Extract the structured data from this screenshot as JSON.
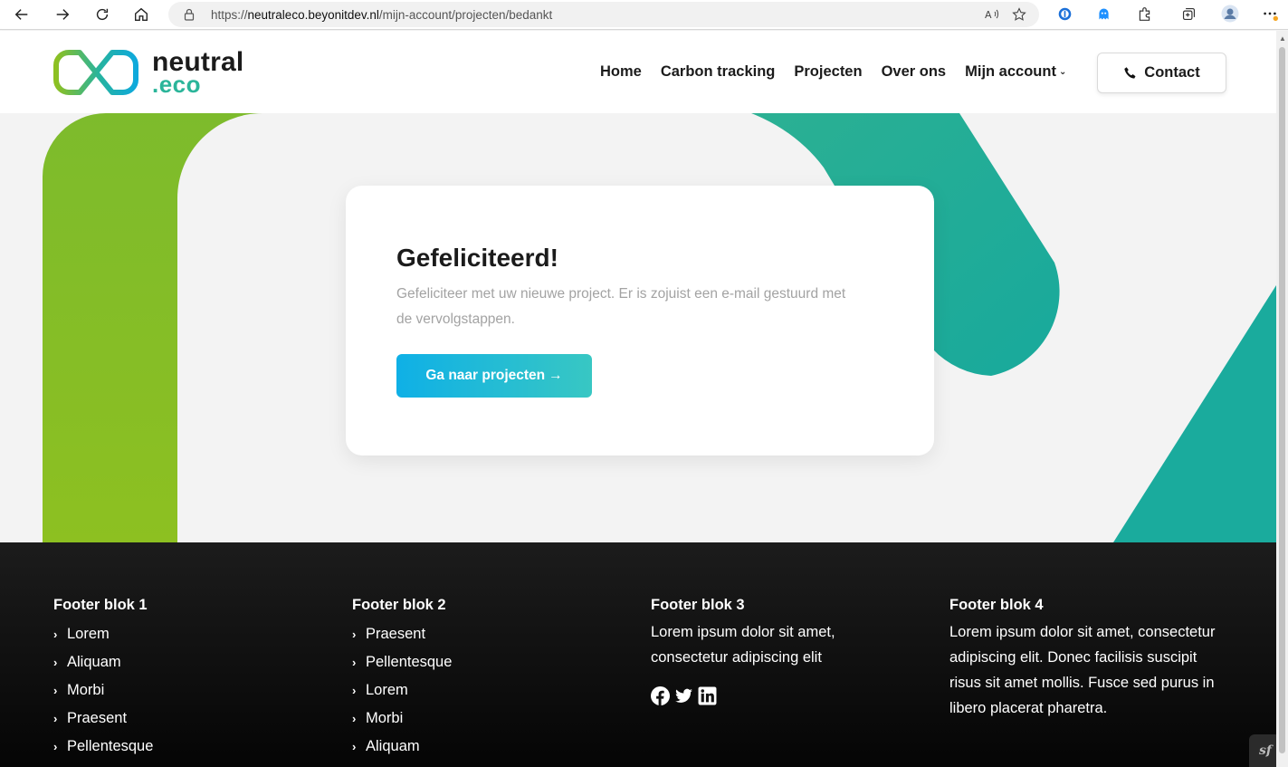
{
  "browser": {
    "url_prefix": "https://",
    "url_host": "neutraleco.beyonitdev.nl",
    "url_path": "/mijn-account/projecten/bedankt",
    "icons": [
      "back-icon",
      "forward-icon",
      "refresh-icon",
      "home-icon",
      "lock-icon",
      "read-aloud-icon",
      "favorite-icon",
      "password-manager-icon",
      "ghostery-icon",
      "extensions-icon",
      "collections-icon",
      "profile-avatar-icon",
      "more-icon"
    ]
  },
  "header": {
    "logo_line1": "neutral",
    "logo_line2": ".eco",
    "nav": [
      {
        "label": "Home"
      },
      {
        "label": "Carbon tracking"
      },
      {
        "label": "Projecten"
      },
      {
        "label": "Over ons"
      },
      {
        "label": "Mijn account"
      }
    ],
    "contact_label": "Contact"
  },
  "card": {
    "title": "Gefeliciteerd!",
    "text": "Gefeliciteer met uw nieuwe project. Er is zojuist een e-mail gestuurd met de vervolgstappen.",
    "button_label": "Ga naar projecten",
    "button_arrow": "→"
  },
  "footer": {
    "col1": {
      "title": "Footer blok 1",
      "items": [
        "Lorem",
        "Aliquam",
        "Morbi",
        "Praesent",
        "Pellentesque"
      ]
    },
    "col2": {
      "title": "Footer blok 2",
      "items": [
        "Praesent",
        "Pellentesque",
        "Lorem",
        "Morbi",
        "Aliquam"
      ]
    },
    "col3": {
      "title": "Footer blok 3",
      "text": "Lorem ipsum dolor sit amet, consectetur adipiscing elit",
      "socials": [
        "facebook-icon",
        "twitter-icon",
        "linkedin-icon"
      ]
    },
    "col4": {
      "title": "Footer blok 4",
      "text": "Lorem ipsum dolor sit amet, consectetur adipiscing elit. Donec facilisis suscipit risus sit amet mollis. Fusce sed purus in libero placerat pharetra."
    }
  },
  "badge": "sf",
  "colors": {
    "brand_green": "#8dc021",
    "brand_teal": "#1ab0a0",
    "button_blue": "#0fb0e6",
    "footer_bg": "#111111"
  }
}
